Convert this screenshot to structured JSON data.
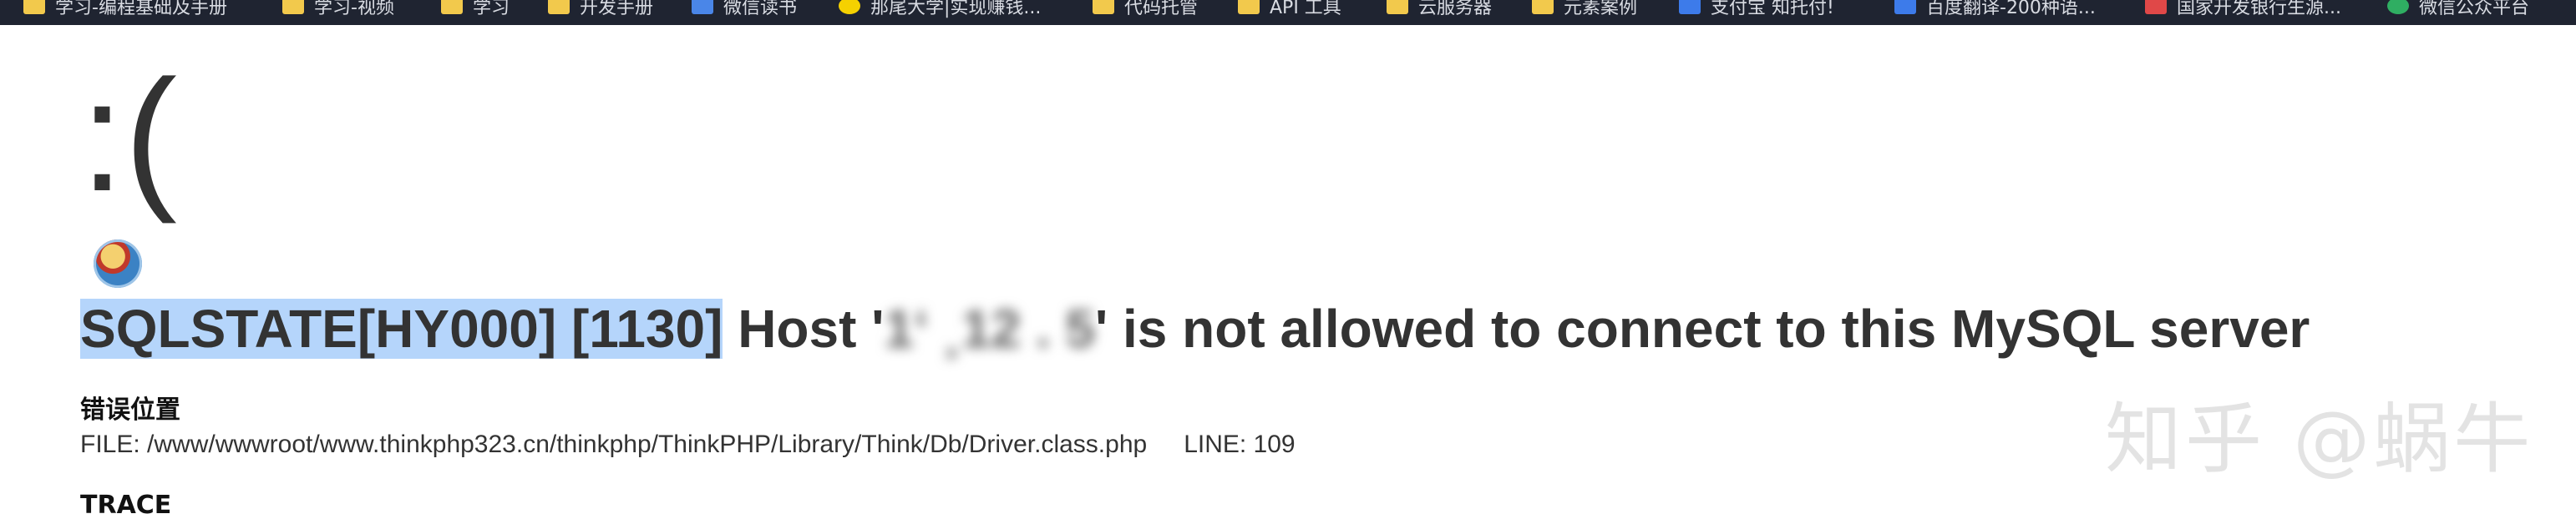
{
  "bookmarks_bar": {
    "items": [
      {
        "label": "学习-编程基础及手册",
        "icon": "folder-icon"
      },
      {
        "label": "学习-视频",
        "icon": "folder-icon"
      },
      {
        "label": "学习",
        "icon": "folder-icon"
      },
      {
        "label": "开发手册",
        "icon": "folder-icon"
      },
      {
        "label": "微信读书",
        "icon": "weread-icon"
      },
      {
        "label": "那尾大学|实现赚钱...",
        "icon": "smiley-icon"
      },
      {
        "label": "代码托管",
        "icon": "folder-icon"
      },
      {
        "label": "API 工具",
        "icon": "folder-icon"
      },
      {
        "label": "云服务器",
        "icon": "folder-icon"
      },
      {
        "label": "元素案例",
        "icon": "folder-icon"
      },
      {
        "label": "支付宝 知托付!",
        "icon": "alipay-icon"
      },
      {
        "label": "百度翻译-200种语...",
        "icon": "translate-icon"
      },
      {
        "label": "国家开发银行生源...",
        "icon": "bank-icon"
      },
      {
        "label": "微信公众平台",
        "icon": "wechat-icon"
      }
    ]
  },
  "error_page": {
    "face": ":(",
    "message_selected": "SQLSTATE[HY000] [1130]",
    "message_before_host": " Host '",
    "message_host_redacted": "1‘ ¸12 .  5",
    "message_after_host": "' is not allowed to connect to this MySQL server",
    "location_title": "错误位置",
    "file_text": "FILE: /www/wwwroot/www.thinkphp323.cn/thinkphp/ThinkPHP/Library/Think/Db/Driver.class.php",
    "line_text": "LINE: 109",
    "trace_title": "TRACE"
  },
  "watermark": {
    "text": "知乎 @蜗牛"
  }
}
